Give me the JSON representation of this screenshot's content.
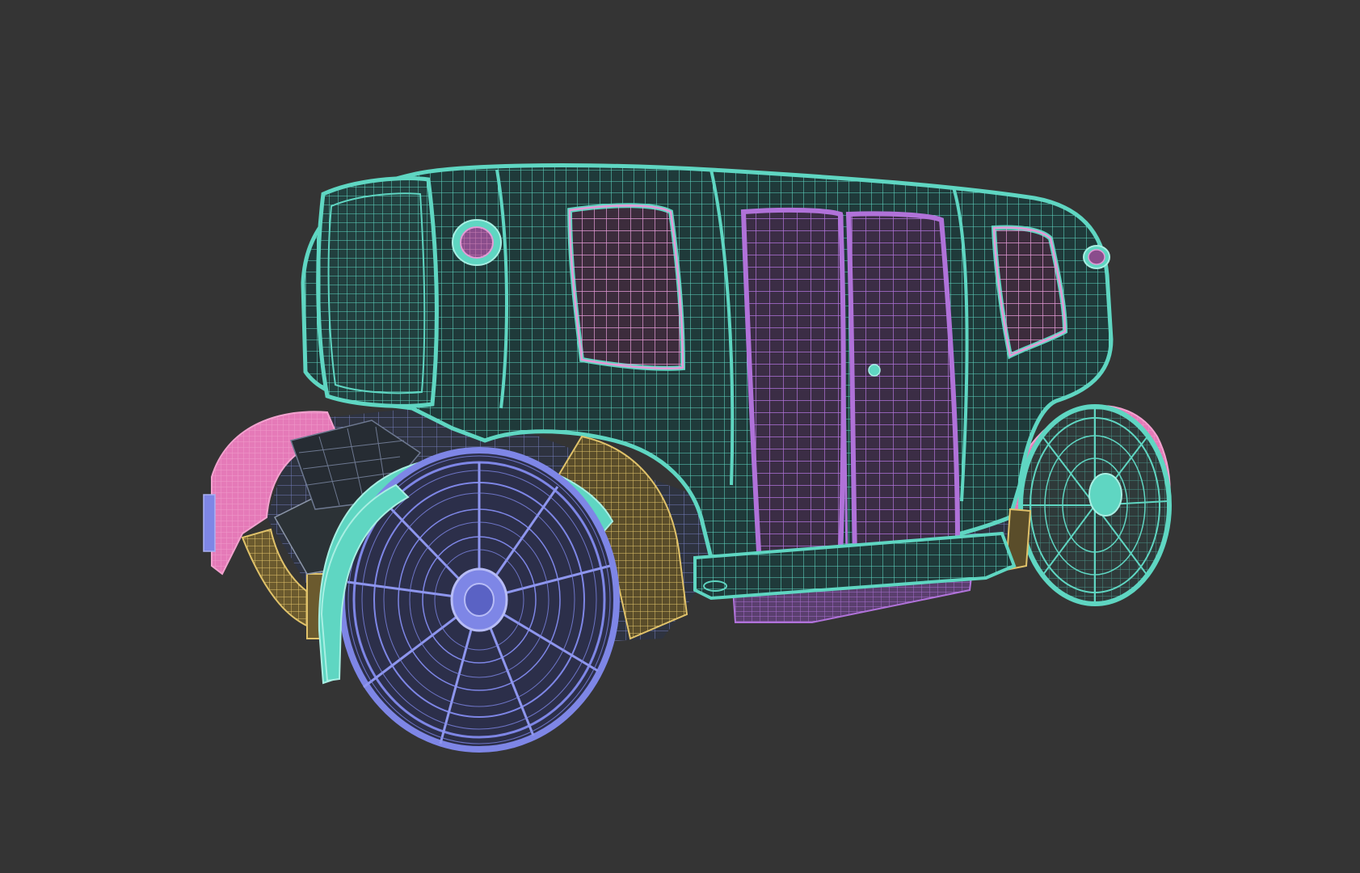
{
  "scene": {
    "subject": "wireframe-vehicle",
    "colors": {
      "background": "#343434",
      "body": "#5fd6c2",
      "body_dark": "#3a8a82",
      "window": "#e39ad6",
      "door": "#b072d9",
      "door_fill": "#4c3a55",
      "front_wheel": "#7e86e6",
      "rear_wheel": "#5fd6c2",
      "fender_pink": "#e57ab8",
      "yellow": "#e0c26a",
      "underbody": "#7c86c8",
      "interior": "#2c3236"
    },
    "icons": [
      "side-mirror-icon",
      "door-handle-icon",
      "wheel-hub-icon"
    ]
  }
}
